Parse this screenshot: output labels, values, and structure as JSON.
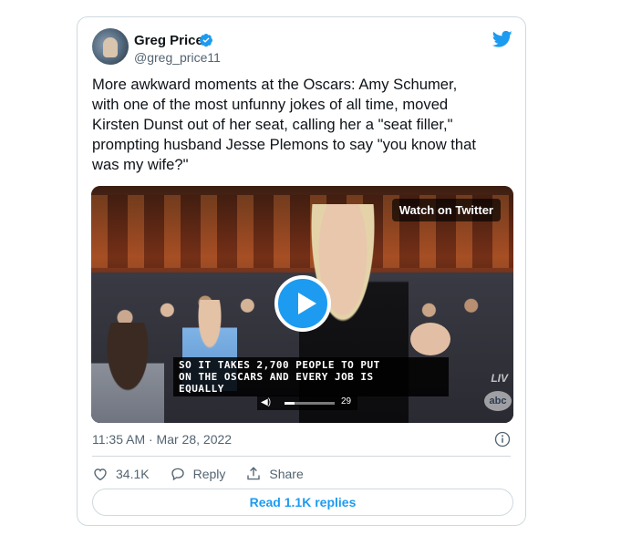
{
  "author": {
    "name": "Greg Price",
    "handle": "@greg_price11",
    "verified": true
  },
  "tweet": {
    "text": "More awkward moments at the Oscars: Amy Schumer,\nwith one of the most unfunny jokes of all time, moved\nKirsten Dunst out of her seat, calling her a \"seat filler,\"\nprompting husband Jesse Plemons to say \"you know that\nwas my wife?\""
  },
  "video": {
    "watch_label": "Watch on Twitter",
    "caption_lines": [
      "SO IT TAKES 2,700 PEOPLE TO PUT",
      "ON THE OSCARS AND EVERY JOB IS",
      "EQUALLY"
    ],
    "counter": "29",
    "progress_fraction": 0.2,
    "live_label": "LIV",
    "network_logo": "abc"
  },
  "meta": {
    "timestamp": "11:35 AM · Mar 28, 2022"
  },
  "actions": {
    "likes": "34.1K",
    "reply_label": "Reply",
    "share_label": "Share"
  },
  "footer": {
    "read_replies_label": "Read 1.1K replies"
  },
  "colors": {
    "accent": "#1d9bf0",
    "text": "#0f1419",
    "muted": "#536471",
    "border": "#cfd9de"
  },
  "icons": [
    "verified-badge-icon",
    "twitter-bird-icon",
    "play-icon",
    "info-icon",
    "heart-icon",
    "reply-icon",
    "share-icon",
    "volume-icon"
  ]
}
